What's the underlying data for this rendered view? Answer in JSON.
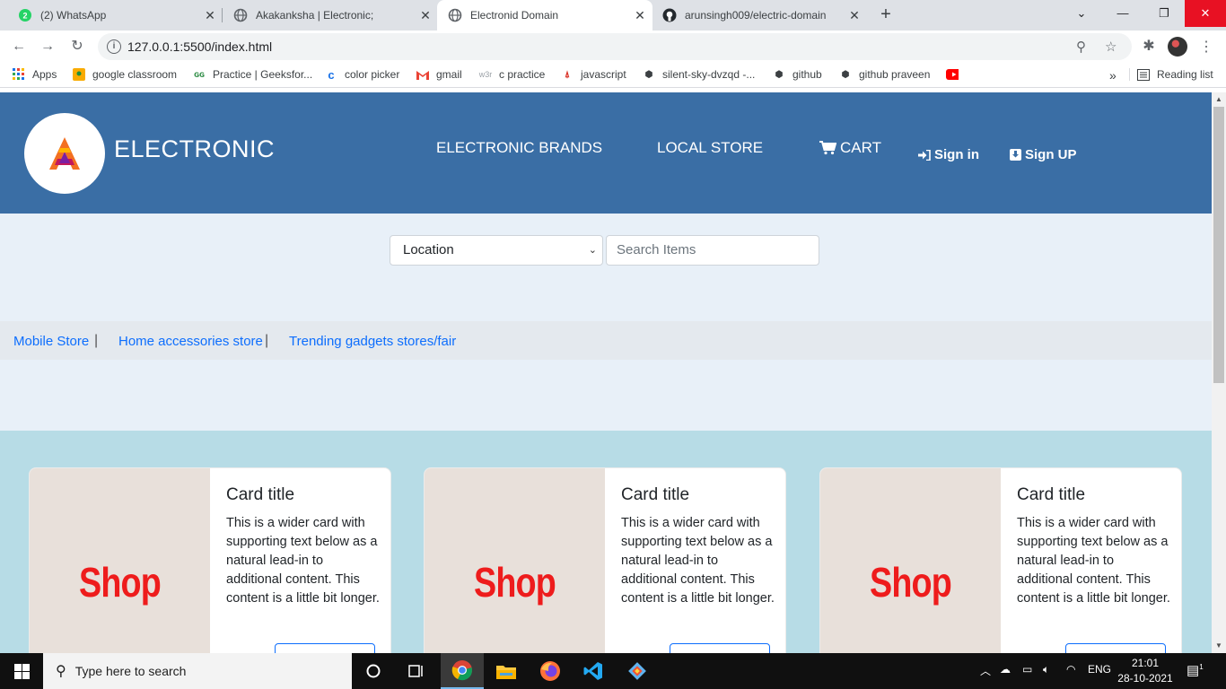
{
  "browser": {
    "tabs": [
      {
        "title": "(2) WhatsApp",
        "icon": "whatsapp-icon",
        "active": false
      },
      {
        "title": "Akakanksha | Electronic;",
        "icon": "globe-icon",
        "active": false
      },
      {
        "title": "Electronid Domain",
        "icon": "globe-icon",
        "active": true
      },
      {
        "title": "arunsingh009/electric-domain",
        "icon": "github-icon",
        "active": false
      }
    ],
    "url": "127.0.0.1:5500/index.html",
    "bookmarks": [
      {
        "label": "Apps",
        "icon": "apps-grid-icon"
      },
      {
        "label": "google classroom",
        "icon": "classroom-icon"
      },
      {
        "label": "Practice | Geeksfor...",
        "icon": "geeksforgeeks-icon"
      },
      {
        "label": "color picker",
        "icon": "color-picker-icon"
      },
      {
        "label": "gmail",
        "icon": "gmail-icon"
      },
      {
        "label": "c practice",
        "icon": "w3schools-icon"
      },
      {
        "label": "javascript",
        "icon": "javascript-icon"
      },
      {
        "label": "silent-sky-dvzqd -...",
        "icon": "codesandbox-icon"
      },
      {
        "label": "github",
        "icon": "codesandbox-icon"
      },
      {
        "label": "github praveen",
        "icon": "codesandbox-icon"
      },
      {
        "label": "",
        "icon": "youtube-icon"
      }
    ],
    "bookmarks_more": "»",
    "reading_list": "Reading list"
  },
  "header": {
    "brand": "ELECTRONIC",
    "nav": {
      "brands": "ELECTRONIC BRANDS",
      "local_store": "LOCAL STORE",
      "cart": "CART",
      "sign_in": "Sign in",
      "sign_up": "Sign UP"
    },
    "brand_color": "#3a6ea5"
  },
  "search": {
    "location_selected": "Location",
    "placeholder": "Search Items"
  },
  "store_links": [
    "Mobile Store",
    "Home accessories store",
    "Trending gadgets stores/fair"
  ],
  "store_link_separator": "|",
  "cards": [
    {
      "image_text": "Shop",
      "title": "Card title",
      "text": "This is a wider card with supporting text below as a natural lead-in to additional content. This content is a little bit longer."
    },
    {
      "image_text": "Shop",
      "title": "Card title",
      "text": "This is a wider card with supporting text below as a natural lead-in to additional content. This content is a little bit longer."
    },
    {
      "image_text": "Shop",
      "title": "Card title",
      "text": "This is a wider card with supporting text below as a natural lead-in to additional content. This content is a little bit longer."
    }
  ],
  "taskbar": {
    "search_placeholder": "Type here to search",
    "language": "ENG",
    "time": "21:01",
    "date": "28-10-2021",
    "notifications": "1"
  }
}
